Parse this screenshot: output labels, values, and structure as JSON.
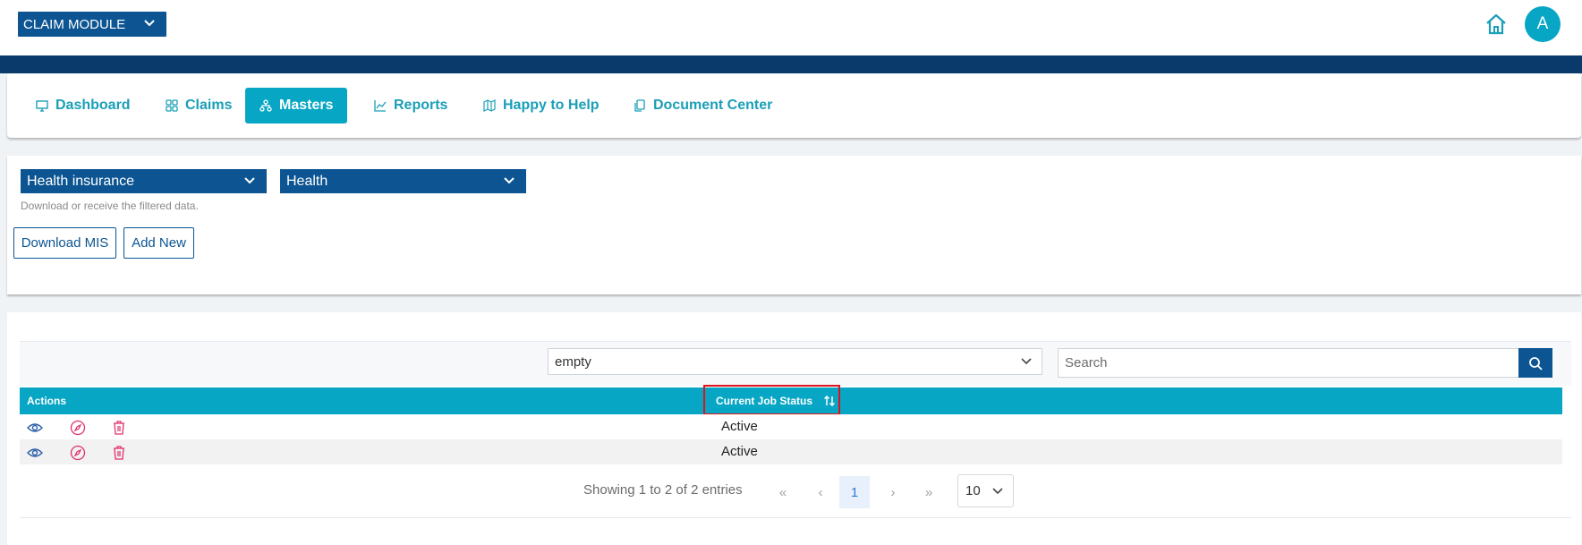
{
  "header": {
    "module_label": "CLAIM MODULE",
    "avatar_letter": "A"
  },
  "nav": {
    "items": [
      {
        "label": "Dashboard",
        "icon": "monitor-icon"
      },
      {
        "label": "Claims",
        "icon": "grid-icon"
      },
      {
        "label": "Masters",
        "icon": "sitemap-icon",
        "active": true
      },
      {
        "label": "Reports",
        "icon": "chart-icon"
      },
      {
        "label": "Happy to Help",
        "icon": "map-icon"
      },
      {
        "label": "Document Center",
        "icon": "documents-icon"
      }
    ]
  },
  "filters": {
    "insurance_type": "Health insurance",
    "product": "Health",
    "hint": "Download or receive the filtered data.",
    "download_label": "Download MIS",
    "add_new_label": "Add New"
  },
  "table": {
    "status_filter_value": "empty",
    "search_placeholder": "Search",
    "columns": [
      "Actions",
      "Current Job Status"
    ],
    "rows": [
      {
        "status": "Active"
      },
      {
        "status": "Active"
      }
    ],
    "paging_text": "Showing 1 to 2 of 2 entries",
    "first_label": "«",
    "prev_label": "‹",
    "current_page": "1",
    "next_label": "›",
    "last_label": "»",
    "page_size": "10"
  },
  "colors": {
    "primary": "#0c5592",
    "accent": "#07a6c4",
    "header_band": "#0a3a6b",
    "highlight": "#e0121d"
  }
}
